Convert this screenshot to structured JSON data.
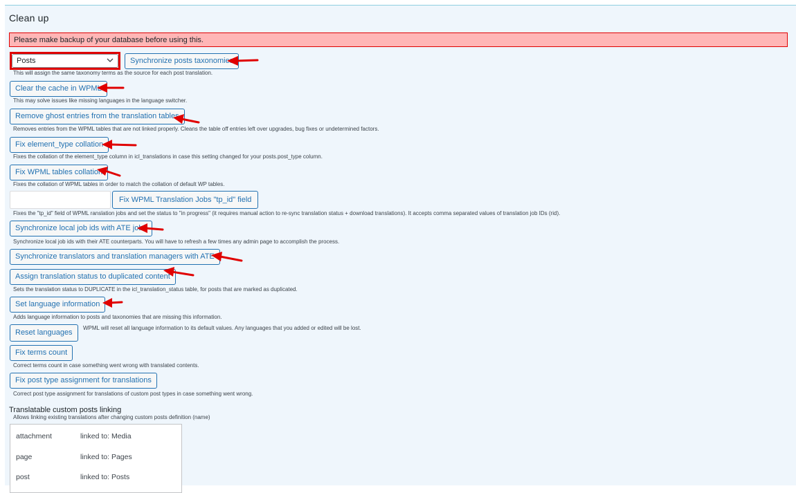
{
  "section": {
    "title": "Clean up",
    "warning": "Please make backup of your database before using this."
  },
  "taxonomy_sync": {
    "select_value": "Posts",
    "button": "Synchronize posts taxonomies",
    "desc": "This will assign the same taxonomy terms as the source for each post translation."
  },
  "actions": [
    {
      "button": "Clear the cache in WPML",
      "desc": "This may solve issues like missing languages in the language switcher."
    },
    {
      "button": "Remove ghost entries from the translation tables",
      "desc": "Removes entries from the WPML tables that are not linked properly. Cleans the table off entries left over upgrades, bug fixes or undetermined factors."
    },
    {
      "button": "Fix element_type collation",
      "desc": "Fixes the collation of the element_type column in icl_translations in case this setting changed for your posts.post_type column."
    },
    {
      "button": "Fix WPML tables collation",
      "desc": "Fixes the collation of WPML tables in order to match the collation of default WP tables."
    },
    {
      "button": "Fix WPML Translation Jobs \"tp_id\" field",
      "desc": "Fixes the \"tp_id\" field of WPML ranslation jobs and set the status to \"in progress\" (it requires manual action to re-sync translation status + download translations). It accepts comma separated values of translation job IDs (rid).",
      "input_value": ""
    },
    {
      "button": "Synchronize local job ids with ATE jobs",
      "desc": "Synchronize local job ids with their ATE counterparts. You will have to refresh a few times any admin page to accomplish the process."
    },
    {
      "button": "Synchronize translators and translation managers with ATE",
      "desc": ""
    },
    {
      "button": "Assign translation status to duplicated content",
      "desc": "Sets the translation status to DUPLICATE in the icl_translation_status table, for posts that are marked as duplicated."
    },
    {
      "button": "Set language information",
      "desc": "Adds language information to posts and taxonomies that are missing this information."
    },
    {
      "button": "Reset languages",
      "desc": "WPML will reset all language information to its default values. Any languages that you added or edited will be lost."
    },
    {
      "button": "Fix terms count",
      "desc": "Correct terms count in case something went wrong with translated contents."
    },
    {
      "button": "Fix post type assignment for translations",
      "desc": "Correct post type assignment for translations of custom post types in case something went wrong."
    }
  ],
  "linking": {
    "label": "Translatable custom posts linking",
    "sub": "Allows linking existing translations after changing custom posts definition (name)",
    "rows": [
      {
        "key": "attachment",
        "value": "linked to: Media"
      },
      {
        "key": "page",
        "value": "linked to: Pages"
      },
      {
        "key": "post",
        "value": "linked to: Posts"
      }
    ]
  },
  "colors": {
    "accent": "#2271b1",
    "warning_bg": "#ffb6b6",
    "annotation_red": "#e00000",
    "panel_bg": "#eff6fc"
  }
}
